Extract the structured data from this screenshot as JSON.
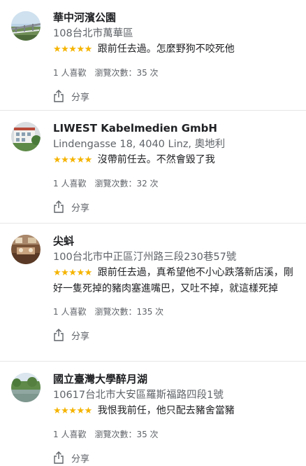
{
  "reviews": [
    {
      "name": "華中河濱公園",
      "address": "108台北市萬華區",
      "stars": "★★★★★",
      "text": "跟前任去過。怎麼野狗不咬死他",
      "likes": "1 人喜歡",
      "views": "瀏覽次數：35 次",
      "share": "分享",
      "avatar": "bridge-photo"
    },
    {
      "name": "LIWEST Kabelmedien GmbH",
      "address": "Lindengasse 18, 4040 Linz, 奧地利",
      "stars": "★★★★★",
      "text": "沒帶前任去。不然會毀了我",
      "likes": "1 人喜歡",
      "views": "瀏覽次數：32 次",
      "share": "分享",
      "avatar": "building-photo"
    },
    {
      "name": "尖蚪",
      "address": "100台北市中正區汀州路三段230巷57號",
      "stars": "★★★★★",
      "text": "跟前任去過，真希望他不小心跌落新店溪，剛好一隻死掉的豬肉塞進嘴巴，又吐不掉，就這樣死掉",
      "likes": "1 人喜歡",
      "views": "瀏覽次數：135 次",
      "share": "分享",
      "avatar": "restaurant-photo"
    },
    {
      "name": "國立臺灣大學醉月湖",
      "address": "10617台北市大安區羅斯福路四段1號",
      "stars": "★★★★★",
      "text": "我恨我前任，他只配去豬舍當豬",
      "likes": "1 人喜歡",
      "views": "瀏覽次數：35 次",
      "share": "分享",
      "avatar": "lake-photo"
    }
  ],
  "colors": {
    "star": "#f5b400",
    "secondary_text": "#5f6368",
    "primary_text": "#202124",
    "divider": "#e6e6e6"
  }
}
